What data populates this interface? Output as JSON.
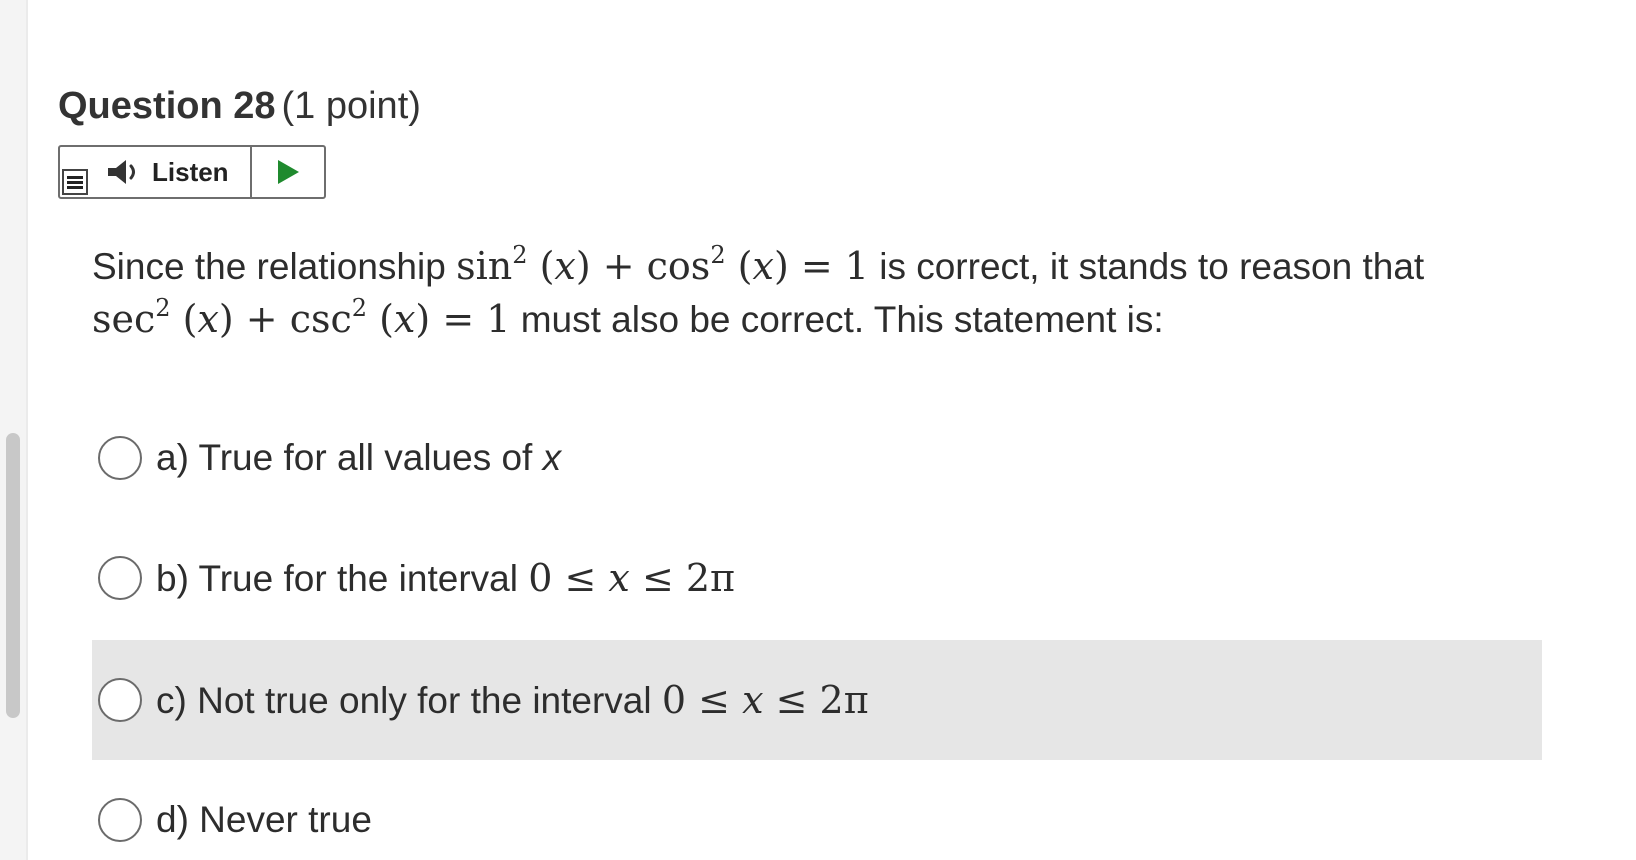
{
  "question": {
    "title": "Question 28",
    "points": "(1 point)"
  },
  "listen": {
    "label": "Listen",
    "menu_icon": "menu-icon",
    "speaker_icon": "speaker-icon",
    "play_icon": "play-icon",
    "play_color": "#1f8a2e"
  },
  "prompt": {
    "text_1": "Since the relationship",
    "identity_1": "sin² (x) + cos² (x) = 1",
    "text_2": "is correct, it stands to reason that",
    "identity_2": "sec² (x) + csc² (x) = 1",
    "text_3": "must also be correct. This statement is:"
  },
  "choices": [
    {
      "label": "a) True for all values of",
      "variable": "x",
      "math": "",
      "selected": false,
      "highlighted": false
    },
    {
      "label": "b) True for the interval",
      "variable": "",
      "math": "0 ≤ x ≤ 2π",
      "selected": false,
      "highlighted": false
    },
    {
      "label": "c) Not true only for the interval",
      "variable": "",
      "math": "0 ≤ x ≤ 2π",
      "selected": false,
      "highlighted": true
    },
    {
      "label": "d) Never true",
      "variable": "",
      "math": "",
      "selected": false,
      "highlighted": false
    }
  ],
  "colors": {
    "highlight_bg": "#e6e6e6",
    "text": "#2d2d2d"
  }
}
